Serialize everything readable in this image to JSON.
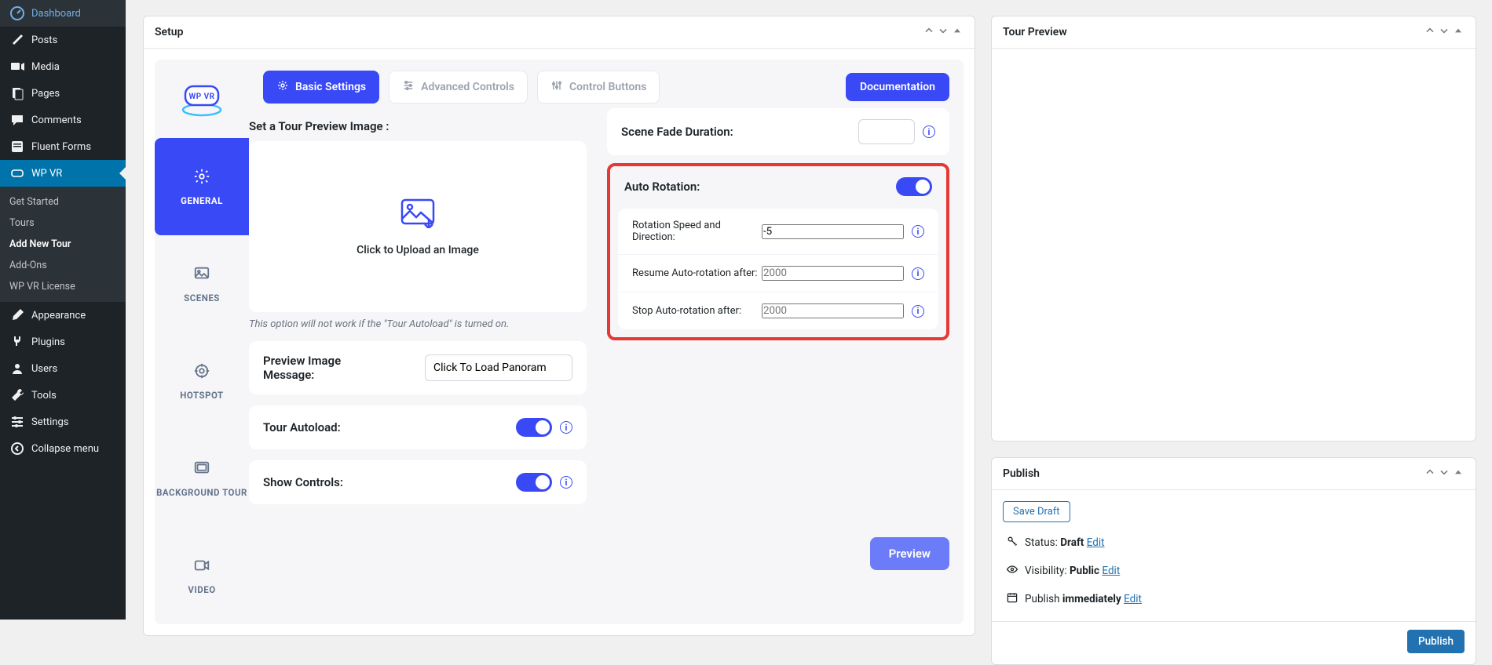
{
  "sidebar": {
    "dashboard": "Dashboard",
    "posts": "Posts",
    "media": "Media",
    "pages": "Pages",
    "comments": "Comments",
    "fluent_forms": "Fluent Forms",
    "wp_vr": "WP VR",
    "sub_get_started": "Get Started",
    "sub_tours": "Tours",
    "sub_add_new": "Add New Tour",
    "sub_addons": "Add-Ons",
    "sub_license": "WP VR License",
    "appearance": "Appearance",
    "plugins": "Plugins",
    "users": "Users",
    "tools": "Tools",
    "settings": "Settings",
    "collapse": "Collapse menu"
  },
  "panel": {
    "setup": "Setup",
    "tour_preview": "Tour Preview",
    "publish": "Publish"
  },
  "tabs": {
    "general": "GENERAL",
    "scenes": "SCENES",
    "hotspot": "HOTSPOT",
    "background": "BACKGROUND TOUR",
    "video": "VIDEO"
  },
  "topbtn": {
    "basic": "Basic Settings",
    "advanced": "Advanced Controls",
    "control": "Control Buttons",
    "docs": "Documentation"
  },
  "left": {
    "set_preview": "Set a Tour Preview Image :",
    "upload": "Click to Upload an Image",
    "note": "This option will not work if the \"Tour Autoload\" is turned on.",
    "preview_msg": "Preview Image Message:",
    "preview_msg_value": "Click To Load Panoram",
    "autoload": "Tour Autoload:",
    "show_controls": "Show Controls:"
  },
  "right": {
    "fade": "Scene Fade Duration:",
    "auto_rot": "Auto Rotation:",
    "rot_speed": "Rotation Speed and Direction:",
    "rot_speed_value": "-5",
    "resume": "Resume Auto-rotation after:",
    "resume_ph": "2000",
    "stop": "Stop Auto-rotation after:",
    "stop_ph": "2000"
  },
  "footer": {
    "preview": "Preview"
  },
  "publish": {
    "save_draft": "Save Draft",
    "status_lbl": "Status: ",
    "status_val": "Draft",
    "visibility_lbl": "Visibility: ",
    "visibility_val": "Public",
    "publish_lbl": "Publish ",
    "publish_val": "immediately",
    "edit": "Edit",
    "btn": "Publish"
  }
}
